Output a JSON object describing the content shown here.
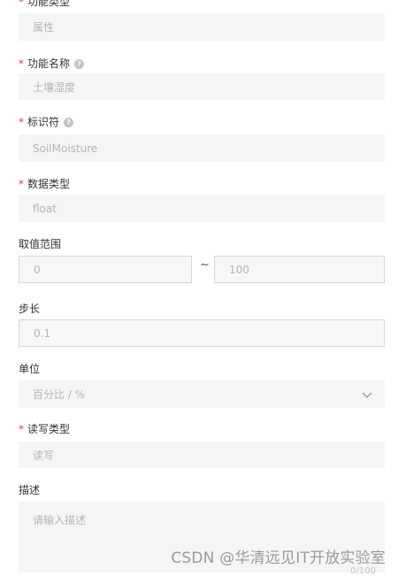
{
  "fields": {
    "func_type": {
      "label": "功能类型",
      "value": "属性"
    },
    "func_name": {
      "label": "功能名称",
      "value": "土壤湿度"
    },
    "identifier": {
      "label": "标识符",
      "value": "SoilMoisture"
    },
    "data_type": {
      "label": "数据类型",
      "value": "float"
    },
    "range": {
      "label": "取值范围",
      "min": "0",
      "separator": "~",
      "max": "100"
    },
    "step": {
      "label": "步长",
      "value": "0.1"
    },
    "unit": {
      "label": "单位",
      "value": "百分比 / %"
    },
    "rw_type": {
      "label": "读写类型",
      "value": "读写"
    },
    "description": {
      "label": "描述",
      "placeholder": "请输入描述",
      "counter": "0/100"
    }
  },
  "help_icon": "?",
  "required_mark": "*",
  "watermark": "CSDN @华清远见IT开放实验室",
  "colors": {
    "required": "#e4393c",
    "field_bg": "#f5f5f5",
    "border": "#d6d6d6"
  }
}
